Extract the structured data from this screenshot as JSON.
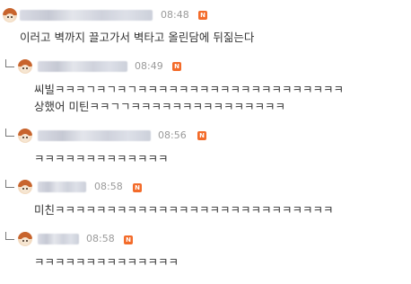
{
  "comments": [
    {
      "is_reply": false,
      "time": "08:48",
      "badge": "N",
      "lines": [
        "이러고 벽까지 끌고가서 벽타고 올린담에 뒤짊는다"
      ]
    },
    {
      "is_reply": true,
      "time": "08:49",
      "badge": "N",
      "lines": [
        "씨빌ㅋㅋㅋㄱㅋㄱㅋㄱㅋㅋㅋㅋㅋㅋㅋㅋㅋㅋㅋㅋㅋㅋㅋㅋㅋㅋㅋㅋ",
        "상했어 미틴ㅋㅋㄱㄱㅋㅋㅋㅋㅋㅋㅋㅋㅋㅋㅋㅋㅋㅋㅋ"
      ]
    },
    {
      "is_reply": true,
      "time": "08:56",
      "badge": "N",
      "lines": [
        "ㅋㅋㅋㅋㅋㅋㅋㅋㅋㅋㅋㅋㅋ"
      ]
    },
    {
      "is_reply": true,
      "time": "08:58",
      "badge": "N",
      "lines": [
        "미친ㅋㅋㅋㅋㅋㅋㅋㅋㅋㅋㅋㅋㅋㅋㅋㅋㅋㅋㅋㅋㅋㅋㅋㅋㅋㅋㅋ"
      ]
    },
    {
      "is_reply": true,
      "time": "08:58",
      "badge": "N",
      "lines": [
        "ㅋㅋㅋㅋㅋㅋㅋㅋㅋㅋㅋㅋㅋㅋ"
      ]
    }
  ]
}
